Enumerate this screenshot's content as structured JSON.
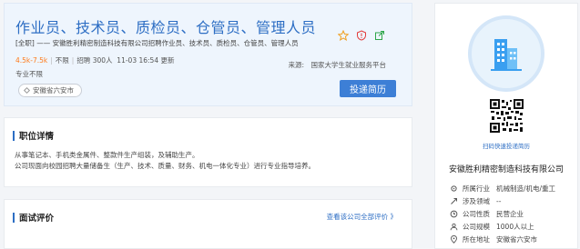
{
  "job": {
    "title": "作业员、技术员、质检员、仓管员、管理人员",
    "subtitle": "[全职] —— 安徽胜利精密制造科技有限公司招聘作业员、技术员、质检员、仓管员、管理人员",
    "salary": "4.5k-7.5k",
    "education": "不限",
    "headcount": "招聘 300人",
    "updated": "11-03 16:54 更新",
    "major": "专业不限",
    "location_tag": "安徽省六安市",
    "source": "来源:　国家大学生就业服务平台",
    "apply_label": "投递简历",
    "icons": [
      "star-icon",
      "report-icon",
      "share-icon"
    ]
  },
  "duty": {
    "heading": "职位详情",
    "lines": [
      "从事笔记本、手机类金属件、整款件生产组装，及辅助生产。",
      "公司现面向校园招聘大量储备生（生产、技术、质量、财务、机电一体化专业）进行专业指导培养。"
    ]
  },
  "review": {
    "heading": "面试评价",
    "link": "查看该公司全部评价 》"
  },
  "company": {
    "qr_caption": "扫码快速投递简历",
    "name": "安徽胜利精密制造科技有限公司",
    "info": [
      {
        "icon": "industry-icon",
        "label": "所属行业",
        "value": "机械制造/机电/重工"
      },
      {
        "icon": "field-icon",
        "label": "涉及领域",
        "value": "--"
      },
      {
        "icon": "nature-icon",
        "label": "公司性质",
        "value": "民营企业"
      },
      {
        "icon": "scale-icon",
        "label": "公司规模",
        "value": "1000人以上"
      },
      {
        "icon": "address-icon",
        "label": "所在地址",
        "value": "安徽省六安市"
      }
    ]
  },
  "colors": {
    "accent": "#2d6ec4",
    "salary": "#ff7a1a",
    "button": "#3d7fd6",
    "report": "#e23b3b",
    "share": "#2fa64a",
    "star": "#f0a020"
  }
}
